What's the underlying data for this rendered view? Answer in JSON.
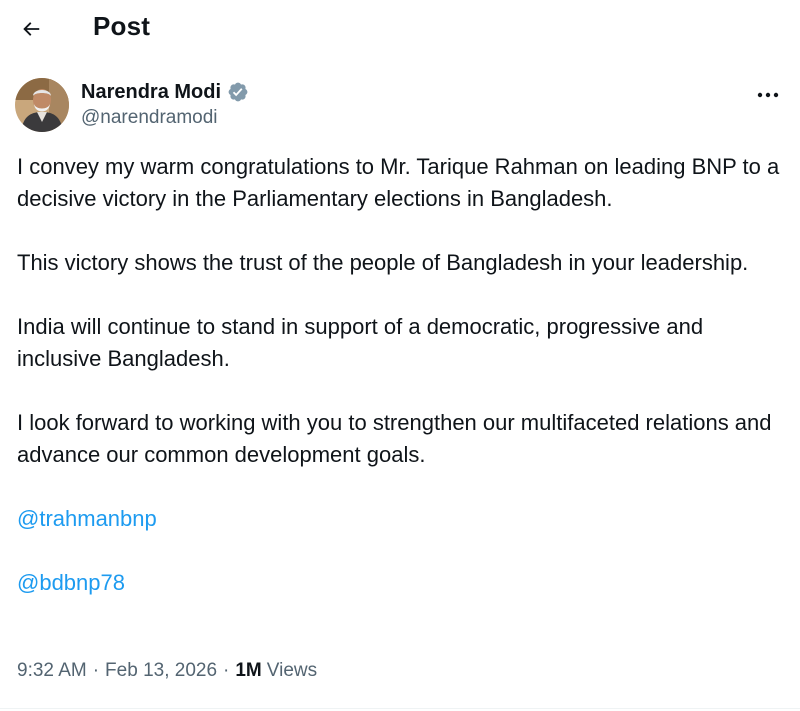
{
  "header": {
    "title": "Post",
    "back_icon": "arrow-left-icon"
  },
  "author": {
    "display_name": "Narendra Modi",
    "handle": "@narendramodi",
    "verified_icon": "verified-badge-icon",
    "verified_color": "#829aab",
    "more_icon": "more-horizontal-icon"
  },
  "post": {
    "paragraphs": [
      "I convey my warm congratulations to Mr. Tarique Rahman on leading BNP to a decisive victory in the Parliamentary elections in Bangladesh.",
      "This victory shows the trust of the people of Bangladesh in your leadership.",
      "India will continue to stand in support of a democratic, progressive and inclusive Bangladesh.",
      "I look forward to working with you to strengthen our multifaceted relations and advance our common development goals."
    ],
    "mentions": [
      "@trahmanbnp",
      "@bdbnp78"
    ],
    "link_color": "#1d9bf0"
  },
  "meta": {
    "time": "9:32 AM",
    "separator": "·",
    "date": "Feb 13, 2026",
    "views_count": "1M",
    "views_label": "Views"
  }
}
